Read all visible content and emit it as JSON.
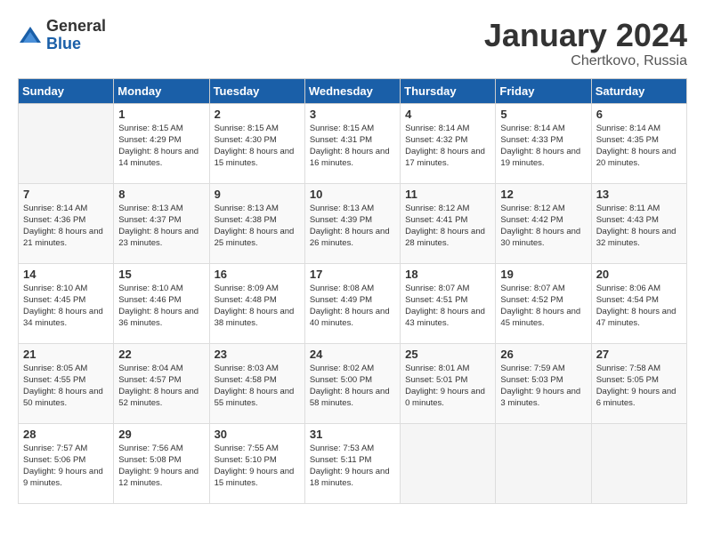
{
  "logo": {
    "general": "General",
    "blue": "Blue"
  },
  "title": "January 2024",
  "location": "Chertkovo, Russia",
  "weekdays": [
    "Sunday",
    "Monday",
    "Tuesday",
    "Wednesday",
    "Thursday",
    "Friday",
    "Saturday"
  ],
  "weeks": [
    [
      {
        "day": "",
        "sunrise": "",
        "sunset": "",
        "daylight": ""
      },
      {
        "day": "1",
        "sunrise": "Sunrise: 8:15 AM",
        "sunset": "Sunset: 4:29 PM",
        "daylight": "Daylight: 8 hours and 14 minutes."
      },
      {
        "day": "2",
        "sunrise": "Sunrise: 8:15 AM",
        "sunset": "Sunset: 4:30 PM",
        "daylight": "Daylight: 8 hours and 15 minutes."
      },
      {
        "day": "3",
        "sunrise": "Sunrise: 8:15 AM",
        "sunset": "Sunset: 4:31 PM",
        "daylight": "Daylight: 8 hours and 16 minutes."
      },
      {
        "day": "4",
        "sunrise": "Sunrise: 8:14 AM",
        "sunset": "Sunset: 4:32 PM",
        "daylight": "Daylight: 8 hours and 17 minutes."
      },
      {
        "day": "5",
        "sunrise": "Sunrise: 8:14 AM",
        "sunset": "Sunset: 4:33 PM",
        "daylight": "Daylight: 8 hours and 19 minutes."
      },
      {
        "day": "6",
        "sunrise": "Sunrise: 8:14 AM",
        "sunset": "Sunset: 4:35 PM",
        "daylight": "Daylight: 8 hours and 20 minutes."
      }
    ],
    [
      {
        "day": "7",
        "sunrise": "Sunrise: 8:14 AM",
        "sunset": "Sunset: 4:36 PM",
        "daylight": "Daylight: 8 hours and 21 minutes."
      },
      {
        "day": "8",
        "sunrise": "Sunrise: 8:13 AM",
        "sunset": "Sunset: 4:37 PM",
        "daylight": "Daylight: 8 hours and 23 minutes."
      },
      {
        "day": "9",
        "sunrise": "Sunrise: 8:13 AM",
        "sunset": "Sunset: 4:38 PM",
        "daylight": "Daylight: 8 hours and 25 minutes."
      },
      {
        "day": "10",
        "sunrise": "Sunrise: 8:13 AM",
        "sunset": "Sunset: 4:39 PM",
        "daylight": "Daylight: 8 hours and 26 minutes."
      },
      {
        "day": "11",
        "sunrise": "Sunrise: 8:12 AM",
        "sunset": "Sunset: 4:41 PM",
        "daylight": "Daylight: 8 hours and 28 minutes."
      },
      {
        "day": "12",
        "sunrise": "Sunrise: 8:12 AM",
        "sunset": "Sunset: 4:42 PM",
        "daylight": "Daylight: 8 hours and 30 minutes."
      },
      {
        "day": "13",
        "sunrise": "Sunrise: 8:11 AM",
        "sunset": "Sunset: 4:43 PM",
        "daylight": "Daylight: 8 hours and 32 minutes."
      }
    ],
    [
      {
        "day": "14",
        "sunrise": "Sunrise: 8:10 AM",
        "sunset": "Sunset: 4:45 PM",
        "daylight": "Daylight: 8 hours and 34 minutes."
      },
      {
        "day": "15",
        "sunrise": "Sunrise: 8:10 AM",
        "sunset": "Sunset: 4:46 PM",
        "daylight": "Daylight: 8 hours and 36 minutes."
      },
      {
        "day": "16",
        "sunrise": "Sunrise: 8:09 AM",
        "sunset": "Sunset: 4:48 PM",
        "daylight": "Daylight: 8 hours and 38 minutes."
      },
      {
        "day": "17",
        "sunrise": "Sunrise: 8:08 AM",
        "sunset": "Sunset: 4:49 PM",
        "daylight": "Daylight: 8 hours and 40 minutes."
      },
      {
        "day": "18",
        "sunrise": "Sunrise: 8:07 AM",
        "sunset": "Sunset: 4:51 PM",
        "daylight": "Daylight: 8 hours and 43 minutes."
      },
      {
        "day": "19",
        "sunrise": "Sunrise: 8:07 AM",
        "sunset": "Sunset: 4:52 PM",
        "daylight": "Daylight: 8 hours and 45 minutes."
      },
      {
        "day": "20",
        "sunrise": "Sunrise: 8:06 AM",
        "sunset": "Sunset: 4:54 PM",
        "daylight": "Daylight: 8 hours and 47 minutes."
      }
    ],
    [
      {
        "day": "21",
        "sunrise": "Sunrise: 8:05 AM",
        "sunset": "Sunset: 4:55 PM",
        "daylight": "Daylight: 8 hours and 50 minutes."
      },
      {
        "day": "22",
        "sunrise": "Sunrise: 8:04 AM",
        "sunset": "Sunset: 4:57 PM",
        "daylight": "Daylight: 8 hours and 52 minutes."
      },
      {
        "day": "23",
        "sunrise": "Sunrise: 8:03 AM",
        "sunset": "Sunset: 4:58 PM",
        "daylight": "Daylight: 8 hours and 55 minutes."
      },
      {
        "day": "24",
        "sunrise": "Sunrise: 8:02 AM",
        "sunset": "Sunset: 5:00 PM",
        "daylight": "Daylight: 8 hours and 58 minutes."
      },
      {
        "day": "25",
        "sunrise": "Sunrise: 8:01 AM",
        "sunset": "Sunset: 5:01 PM",
        "daylight": "Daylight: 9 hours and 0 minutes."
      },
      {
        "day": "26",
        "sunrise": "Sunrise: 7:59 AM",
        "sunset": "Sunset: 5:03 PM",
        "daylight": "Daylight: 9 hours and 3 minutes."
      },
      {
        "day": "27",
        "sunrise": "Sunrise: 7:58 AM",
        "sunset": "Sunset: 5:05 PM",
        "daylight": "Daylight: 9 hours and 6 minutes."
      }
    ],
    [
      {
        "day": "28",
        "sunrise": "Sunrise: 7:57 AM",
        "sunset": "Sunset: 5:06 PM",
        "daylight": "Daylight: 9 hours and 9 minutes."
      },
      {
        "day": "29",
        "sunrise": "Sunrise: 7:56 AM",
        "sunset": "Sunset: 5:08 PM",
        "daylight": "Daylight: 9 hours and 12 minutes."
      },
      {
        "day": "30",
        "sunrise": "Sunrise: 7:55 AM",
        "sunset": "Sunset: 5:10 PM",
        "daylight": "Daylight: 9 hours and 15 minutes."
      },
      {
        "day": "31",
        "sunrise": "Sunrise: 7:53 AM",
        "sunset": "Sunset: 5:11 PM",
        "daylight": "Daylight: 9 hours and 18 minutes."
      },
      {
        "day": "",
        "sunrise": "",
        "sunset": "",
        "daylight": ""
      },
      {
        "day": "",
        "sunrise": "",
        "sunset": "",
        "daylight": ""
      },
      {
        "day": "",
        "sunrise": "",
        "sunset": "",
        "daylight": ""
      }
    ]
  ]
}
